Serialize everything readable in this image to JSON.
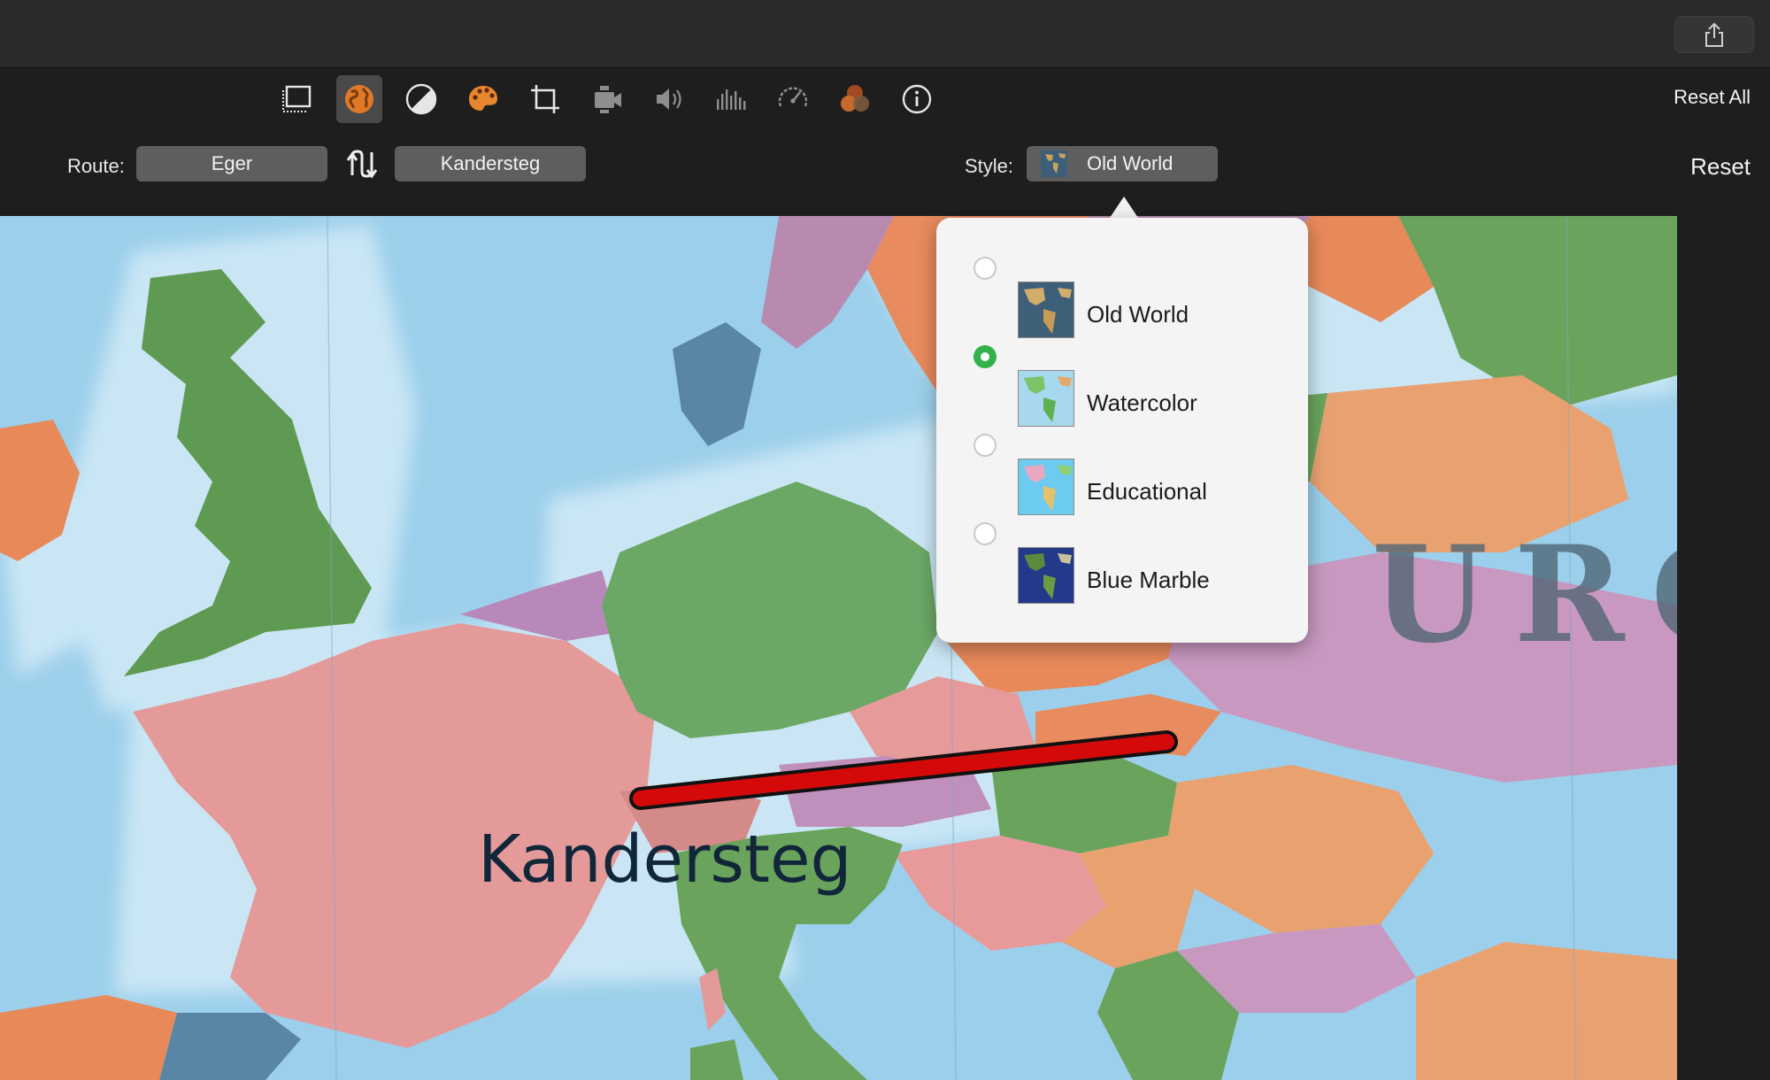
{
  "toolbar": {
    "reset_all_label": "Reset All",
    "tools": [
      {
        "name": "crop-frame-icon",
        "active": false
      },
      {
        "name": "globe-icon",
        "active": true
      },
      {
        "name": "color-balance-icon",
        "active": false
      },
      {
        "name": "palette-icon",
        "active": false
      },
      {
        "name": "crop-icon",
        "active": false
      },
      {
        "name": "video-camera-icon",
        "active": false
      },
      {
        "name": "speaker-icon",
        "active": false
      },
      {
        "name": "equalizer-icon",
        "active": false
      },
      {
        "name": "speedometer-icon",
        "active": false
      },
      {
        "name": "color-filters-icon",
        "active": false
      },
      {
        "name": "info-icon",
        "active": false
      }
    ]
  },
  "route": {
    "label": "Route:",
    "from": "Eger",
    "to": "Kandersteg"
  },
  "style": {
    "label": "Style:",
    "selected": "Old World"
  },
  "reset_label": "Reset",
  "style_menu": {
    "options": [
      {
        "label": "Old World",
        "selected": false
      },
      {
        "label": "Watercolor",
        "selected": true
      },
      {
        "label": "Educational",
        "selected": false
      },
      {
        "label": "Blue Marble",
        "selected": false
      }
    ]
  },
  "map": {
    "destination_label": "Kandersteg",
    "region_label": "UROP",
    "route_color": "#d40a0a"
  }
}
